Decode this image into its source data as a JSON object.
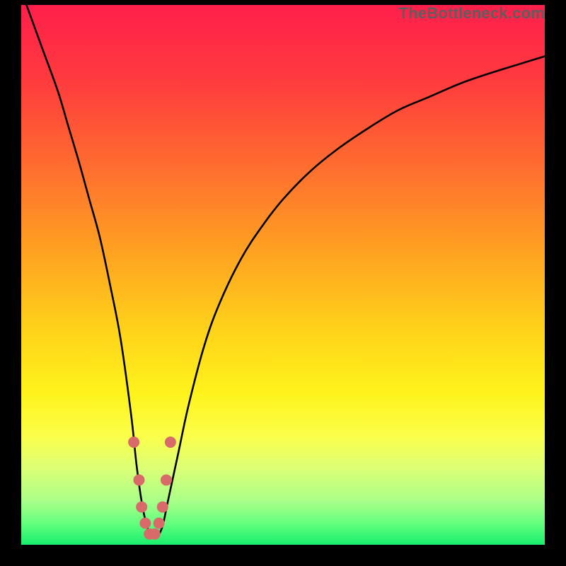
{
  "watermark": "TheBottleneck.com",
  "chart_data": {
    "type": "line",
    "title": "",
    "xlabel": "",
    "ylabel": "",
    "xlim": [
      0,
      100
    ],
    "ylim": [
      0,
      100
    ],
    "background_gradient": {
      "stops": [
        {
          "pct": 0,
          "color": "#ff1f4b"
        },
        {
          "pct": 14,
          "color": "#ff3b3e"
        },
        {
          "pct": 30,
          "color": "#ff6d2f"
        },
        {
          "pct": 46,
          "color": "#ffa321"
        },
        {
          "pct": 60,
          "color": "#ffd21a"
        },
        {
          "pct": 72,
          "color": "#fff31c"
        },
        {
          "pct": 80,
          "color": "#faff4b"
        },
        {
          "pct": 86,
          "color": "#dbff77"
        },
        {
          "pct": 92,
          "color": "#a8ff88"
        },
        {
          "pct": 96,
          "color": "#64ff7e"
        },
        {
          "pct": 100,
          "color": "#18ef6d"
        }
      ]
    },
    "series": [
      {
        "name": "bottleneck-curve",
        "color": "#000000",
        "x": [
          1,
          4,
          7,
          9,
          11,
          13,
          15,
          17,
          19,
          21,
          22,
          23,
          24,
          25,
          26,
          27,
          28,
          30,
          32,
          35,
          38,
          42,
          46,
          50,
          55,
          60,
          66,
          72,
          78,
          84,
          90,
          95,
          100
        ],
        "values": [
          100,
          92,
          84,
          77.5,
          71,
          64,
          57,
          48,
          38,
          24,
          15,
          8,
          3.5,
          1.5,
          1.5,
          3.5,
          8,
          17,
          26,
          37,
          45,
          53,
          59,
          64,
          69,
          73,
          77,
          80.5,
          83,
          85.5,
          87.5,
          89,
          90.5
        ]
      }
    ],
    "markers": {
      "name": "highlight-dots",
      "color": "#d86a6a",
      "radius": 8,
      "x": [
        21.5,
        22.5,
        23.0,
        23.7,
        24.5,
        25.5,
        26.3,
        27.0,
        27.7,
        28.5
      ],
      "values": [
        19,
        12,
        7,
        4,
        2,
        2,
        4,
        7,
        12,
        19
      ]
    }
  }
}
